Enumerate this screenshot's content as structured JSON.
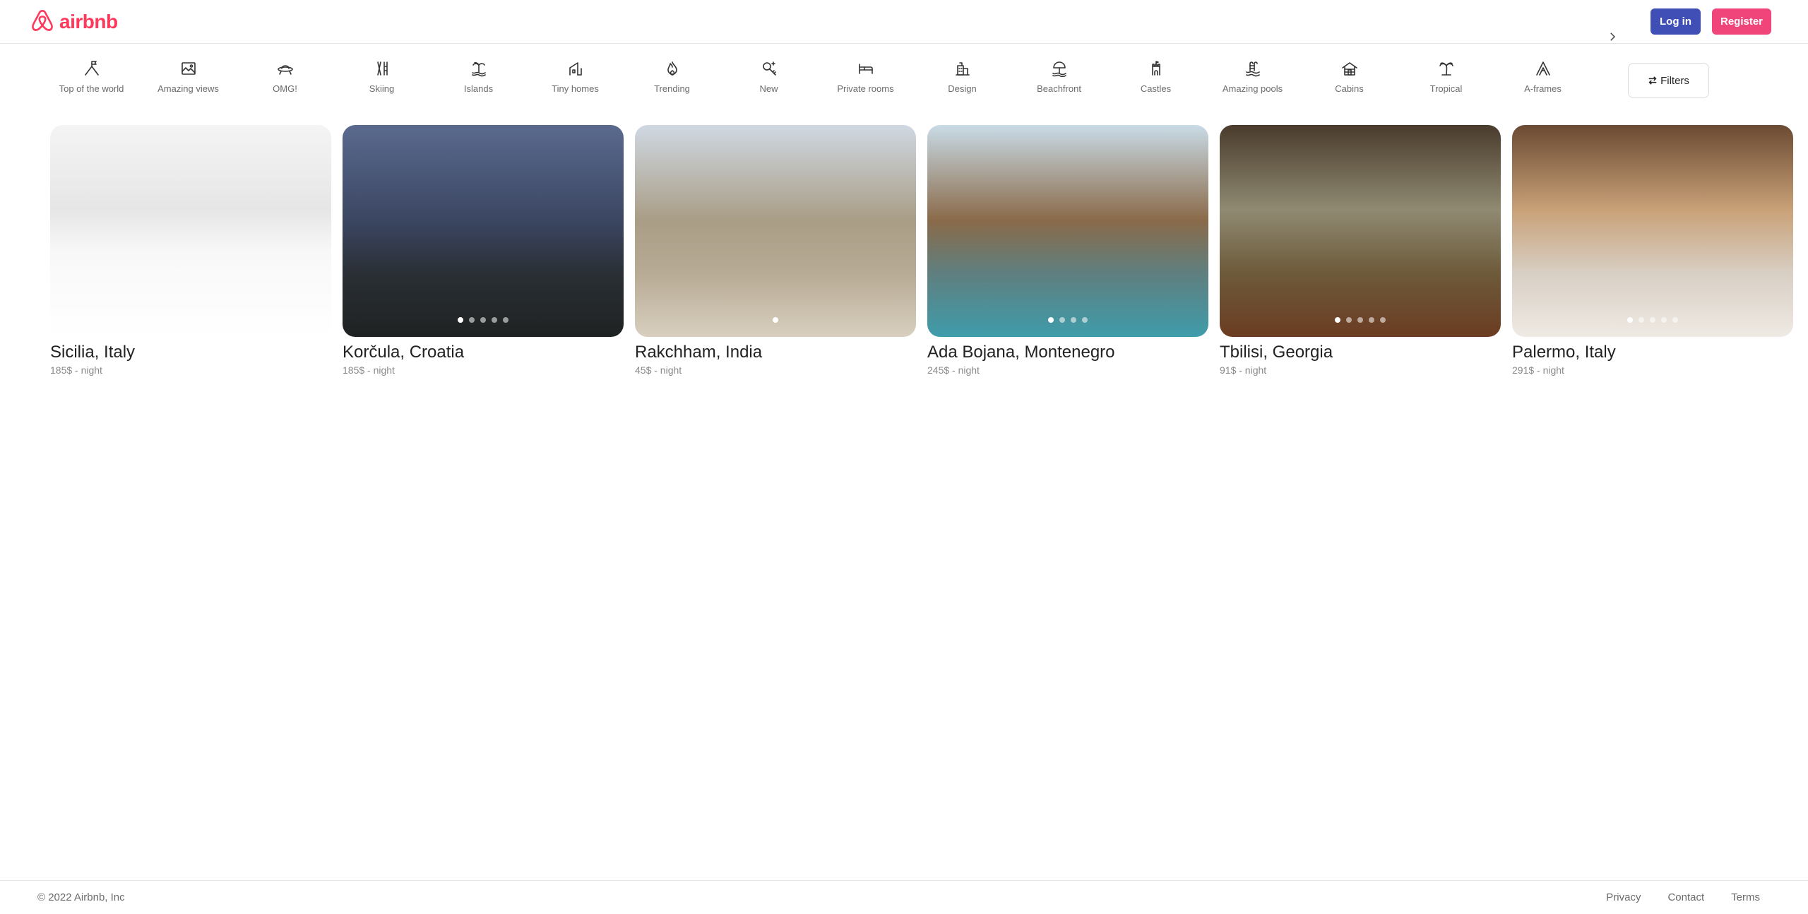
{
  "brand": {
    "name": "airbnb",
    "color": "#ff385c",
    "icon": "airbnb-logo-icon"
  },
  "header": {
    "login_label": "Log in",
    "register_label": "Register",
    "login_color": "#3f4fb5",
    "register_color": "#f0457b"
  },
  "categories": [
    {
      "label": "Top of the world",
      "icon": "mountain-flag-icon"
    },
    {
      "label": "Amazing views",
      "icon": "framed-picture-icon"
    },
    {
      "label": "OMG!",
      "icon": "ufo-icon"
    },
    {
      "label": "Skiing",
      "icon": "skis-icon"
    },
    {
      "label": "Islands",
      "icon": "island-palm-icon"
    },
    {
      "label": "Tiny homes",
      "icon": "tiny-home-icon"
    },
    {
      "label": "Trending",
      "icon": "flame-icon"
    },
    {
      "label": "New",
      "icon": "sparkle-key-icon"
    },
    {
      "label": "Private rooms",
      "icon": "bed-icon"
    },
    {
      "label": "Design",
      "icon": "design-building-icon"
    },
    {
      "label": "Beachfront",
      "icon": "beach-umbrella-icon"
    },
    {
      "label": "Castles",
      "icon": "castle-icon"
    },
    {
      "label": "Amazing pools",
      "icon": "pool-ladder-icon"
    },
    {
      "label": "Cabins",
      "icon": "cabin-icon"
    },
    {
      "label": "Tropical",
      "icon": "palm-tree-icon"
    },
    {
      "label": "A-frames",
      "icon": "a-frame-icon"
    }
  ],
  "filters": {
    "label": "Filters",
    "icon": "sliders-icon"
  },
  "listings": [
    {
      "title": "Sicilia, Italy",
      "price": "185$ - night",
      "dots": 0,
      "active_dot": 0
    },
    {
      "title": "Korčula, Croatia",
      "price": "185$ - night",
      "dots": 5,
      "active_dot": 0
    },
    {
      "title": "Rakchham, India",
      "price": "45$ - night",
      "dots": 1,
      "active_dot": 0
    },
    {
      "title": "Ada Bojana, Montenegro",
      "price": "245$ - night",
      "dots": 4,
      "active_dot": 0
    },
    {
      "title": "Tbilisi, Georgia",
      "price": "91$ - night",
      "dots": 5,
      "active_dot": 0
    },
    {
      "title": "Palermo, Italy",
      "price": "291$ - night",
      "dots": 5,
      "active_dot": 0
    }
  ],
  "footer": {
    "copyright": "© 2022 Airbnb, Inc",
    "links": [
      "Privacy",
      "Contact",
      "Terms"
    ]
  }
}
